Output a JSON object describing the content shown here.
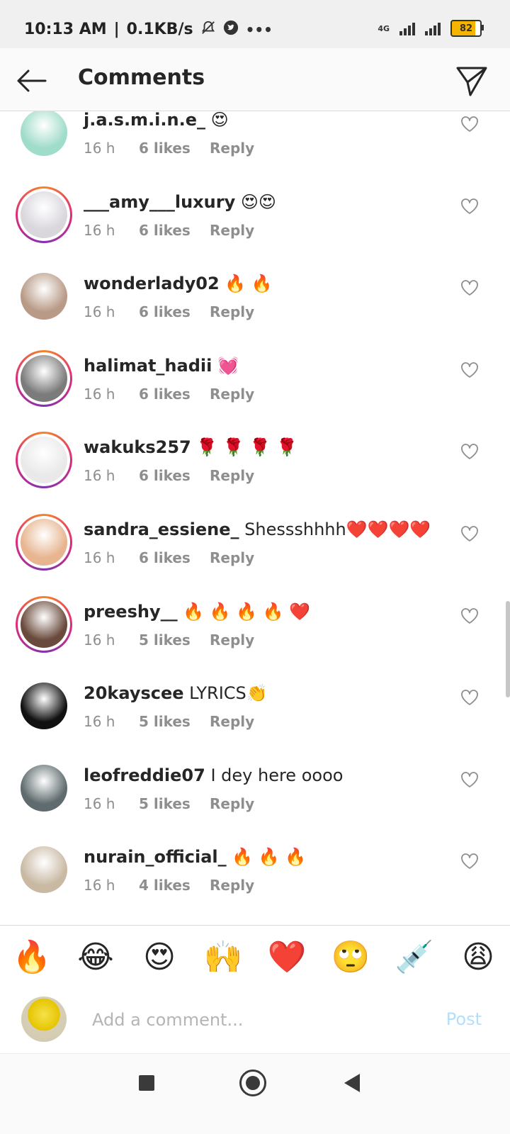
{
  "status_bar": {
    "time": "10:13 AM",
    "network_speed": "0.1KB/s",
    "network_type": "4G",
    "battery": "82",
    "icons": [
      "mute-bell-icon",
      "twitter-icon",
      "more-dots-icon"
    ]
  },
  "header": {
    "title": "Comments",
    "back_icon": "arrow-left-icon",
    "share_icon": "paper-plane-icon"
  },
  "comments": [
    {
      "username": "j.a.s.m.i.n.e_",
      "text": "😍",
      "time": "16 h",
      "likes": "6 likes",
      "reply": "Reply",
      "story": false,
      "avatar_color": "#9fdcc9"
    },
    {
      "username": "___amy___luxury",
      "text": "😍😍",
      "time": "16 h",
      "likes": "6 likes",
      "reply": "Reply",
      "story": true,
      "avatar_color": "#d9d6dc"
    },
    {
      "username": "wonderlady02",
      "text": "🔥 🔥",
      "time": "16 h",
      "likes": "6 likes",
      "reply": "Reply",
      "story": false,
      "avatar_color": "#b89a86"
    },
    {
      "username": "halimat_hadii",
      "text": "💓",
      "time": "16 h",
      "likes": "6 likes",
      "reply": "Reply",
      "story": true,
      "avatar_color": "#7b7b7b"
    },
    {
      "username": "wakuks257",
      "text": "🌹 🌹 🌹 🌹",
      "time": "16 h",
      "likes": "6 likes",
      "reply": "Reply",
      "story": true,
      "avatar_color": "#e9e9e9"
    },
    {
      "username": "sandra_essiene_",
      "text": "Shessshhhh❤️❤️❤️❤️",
      "time": "16 h",
      "likes": "6 likes",
      "reply": "Reply",
      "story": true,
      "avatar_color": "#e7b58f"
    },
    {
      "username": "preeshy__",
      "text": "🔥 🔥 🔥 🔥 ❤️",
      "time": "16 h",
      "likes": "5 likes",
      "reply": "Reply",
      "story": true,
      "avatar_color": "#6a4a3c"
    },
    {
      "username": "20kayscee",
      "text": "LYRICS👏",
      "time": "16 h",
      "likes": "5 likes",
      "reply": "Reply",
      "story": false,
      "avatar_color": "#111111"
    },
    {
      "username": "leofreddie07",
      "text": "I dey here oooo",
      "time": "16 h",
      "likes": "5 likes",
      "reply": "Reply",
      "story": false,
      "avatar_color": "#5f6b6e"
    },
    {
      "username": "nurain_official_",
      "text": "🔥 🔥 🔥",
      "time": "16 h",
      "likes": "4 likes",
      "reply": "Reply",
      "story": false,
      "avatar_color": "#c9b9a3"
    }
  ],
  "emoji_bar": [
    "🔥",
    "😂",
    "😍",
    "🙌",
    "❤️",
    "🙄",
    "💉",
    "😩"
  ],
  "comment_input": {
    "placeholder": "Add a comment...",
    "post_label": "Post"
  },
  "nav_bar": {
    "icons": [
      "recent-apps-icon",
      "home-icon",
      "back-icon"
    ]
  }
}
